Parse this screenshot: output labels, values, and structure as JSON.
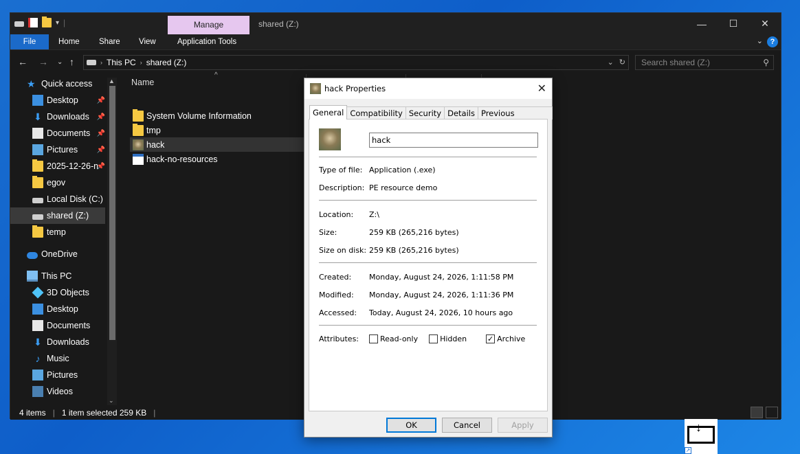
{
  "window": {
    "title": "shared (Z:)",
    "manage_tab": "Manage",
    "controls": [
      "—",
      "☐",
      "✕"
    ]
  },
  "ribbon": {
    "tabs": [
      "File",
      "Home",
      "Share",
      "View",
      "Application Tools"
    ]
  },
  "address": {
    "crumbs": [
      "This PC",
      "shared (Z:)"
    ],
    "search_placeholder": "Search shared (Z:)"
  },
  "nav": {
    "items": [
      {
        "label": "Quick access",
        "icon": "star-icon"
      },
      {
        "label": "Desktop",
        "icon": "desktop-icon",
        "pinned": true
      },
      {
        "label": "Downloads",
        "icon": "download-icon",
        "pinned": true
      },
      {
        "label": "Documents",
        "icon": "documents-icon",
        "pinned": true
      },
      {
        "label": "Pictures",
        "icon": "pictures-icon",
        "pinned": true
      },
      {
        "label": "2025-12-26-n",
        "icon": "folder-icon",
        "pinned": true
      },
      {
        "label": "egov",
        "icon": "folder-icon"
      },
      {
        "label": "Local Disk (C:)",
        "icon": "drive-icon"
      },
      {
        "label": "shared (Z:)",
        "icon": "network-drive-icon",
        "selected": true
      },
      {
        "label": "temp",
        "icon": "folder-icon"
      },
      {
        "label": "OneDrive",
        "icon": "cloud-icon"
      },
      {
        "label": "This PC",
        "icon": "pc-icon"
      },
      {
        "label": "3D Objects",
        "icon": "cube-icon"
      },
      {
        "label": "Desktop",
        "icon": "desktop-icon"
      },
      {
        "label": "Documents",
        "icon": "documents-icon"
      },
      {
        "label": "Downloads",
        "icon": "download-icon"
      },
      {
        "label": "Music",
        "icon": "music-icon"
      },
      {
        "label": "Pictures",
        "icon": "pictures-icon"
      },
      {
        "label": "Videos",
        "icon": "videos-icon"
      }
    ]
  },
  "files": {
    "column_name": "Name",
    "rows": [
      {
        "name": "System Volume Information",
        "icon": "folder-icon"
      },
      {
        "name": "tmp",
        "icon": "folder-icon"
      },
      {
        "name": "hack",
        "icon": "app-image-icon",
        "selected": true
      },
      {
        "name": "hack-no-resources",
        "icon": "window-app-icon"
      }
    ]
  },
  "status": {
    "items": "4 items",
    "selection": "1 item selected  259 KB"
  },
  "dialog": {
    "title": "hack Properties",
    "tabs": [
      "General",
      "Compatibility",
      "Security",
      "Details",
      "Previous Versions"
    ],
    "name_value": "hack",
    "type_label": "Type of file:",
    "type_value": "Application (.exe)",
    "desc_label": "Description:",
    "desc_value": "PE resource demo",
    "location_label": "Location:",
    "location_value": "Z:\\",
    "size_label": "Size:",
    "size_value": "259 KB (265,216 bytes)",
    "disk_label": "Size on disk:",
    "disk_value": "259 KB (265,216 bytes)",
    "created_label": "Created:",
    "created_value": "Monday, August 24, 2026, 1:11:58 PM",
    "modified_label": "Modified:",
    "modified_value": "Monday, August 24, 2026, 1:11:36 PM",
    "accessed_label": "Accessed:",
    "accessed_value": "Today, August 24, 2026, 10 hours ago",
    "attributes_label": "Attributes:",
    "attributes": [
      {
        "label": "Read-only",
        "checked": false
      },
      {
        "label": "Hidden",
        "checked": false
      },
      {
        "label": "Archive",
        "checked": true
      }
    ],
    "ok": "OK",
    "cancel": "Cancel",
    "apply": "Apply"
  },
  "colors": {
    "accent": "#0078d7",
    "file_tab": "#1b6ac9",
    "manage_tab": "#e6c7ef",
    "dark_bg": "#191919"
  }
}
